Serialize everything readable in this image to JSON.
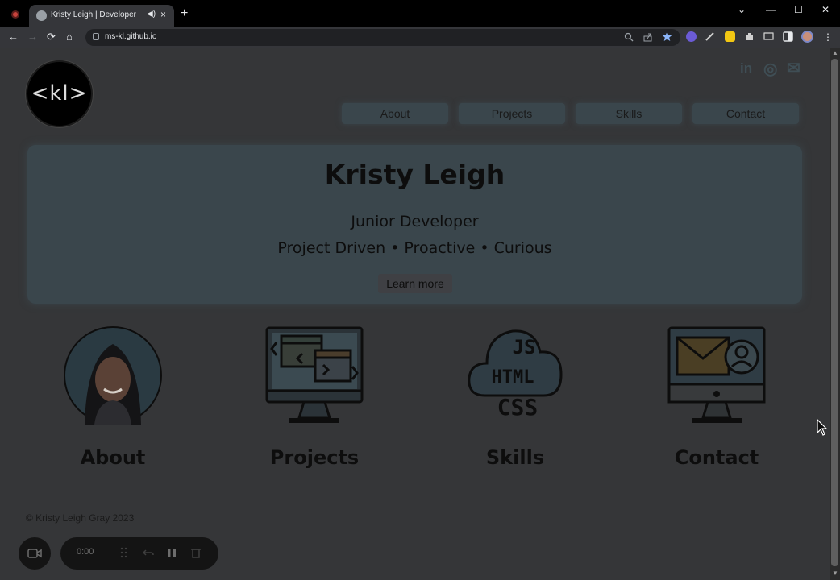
{
  "browser": {
    "tab_title": "Kristy Leigh | Developer",
    "tab_close_glyph": "×",
    "tab_audio_glyph": "◀)",
    "newtab_glyph": "+",
    "url": "ms-kl.github.io",
    "window_controls": {
      "collapse": "⌄",
      "minimize": "—",
      "maximize": "☐",
      "close": "✕"
    },
    "nav": {
      "back": "←",
      "forward": "→",
      "reload": "⟳",
      "home": "⌂"
    },
    "menu_glyph": "⋮"
  },
  "site": {
    "logo_text": "<kl>",
    "social": {
      "linkedin": "in",
      "github": "◎",
      "mail": "✉"
    },
    "nav": [
      {
        "label": "About"
      },
      {
        "label": "Projects"
      },
      {
        "label": "Skills"
      },
      {
        "label": "Contact"
      }
    ],
    "hero": {
      "name": "Kristy Leigh",
      "role": "Junior Developer",
      "tagline": "Project Driven • Proactive • Curious",
      "button": "Learn more"
    },
    "cards": [
      {
        "label": "About",
        "icon": "profile-photo"
      },
      {
        "label": "Projects",
        "icon": "code-monitor-icon"
      },
      {
        "label": "Skills",
        "icon": "js-html-css-cloud-icon"
      },
      {
        "label": "Contact",
        "icon": "mail-monitor-icon"
      }
    ],
    "skills_icon_text": {
      "js": "JS",
      "html": "HTML",
      "css": "CSS"
    },
    "footer": "© Kristy Leigh Gray 2023"
  },
  "recorder": {
    "time": "0:00"
  },
  "colors": {
    "page_bg": "#353638",
    "panel": "#3a464c",
    "text_dark": "#0d0d0d"
  }
}
